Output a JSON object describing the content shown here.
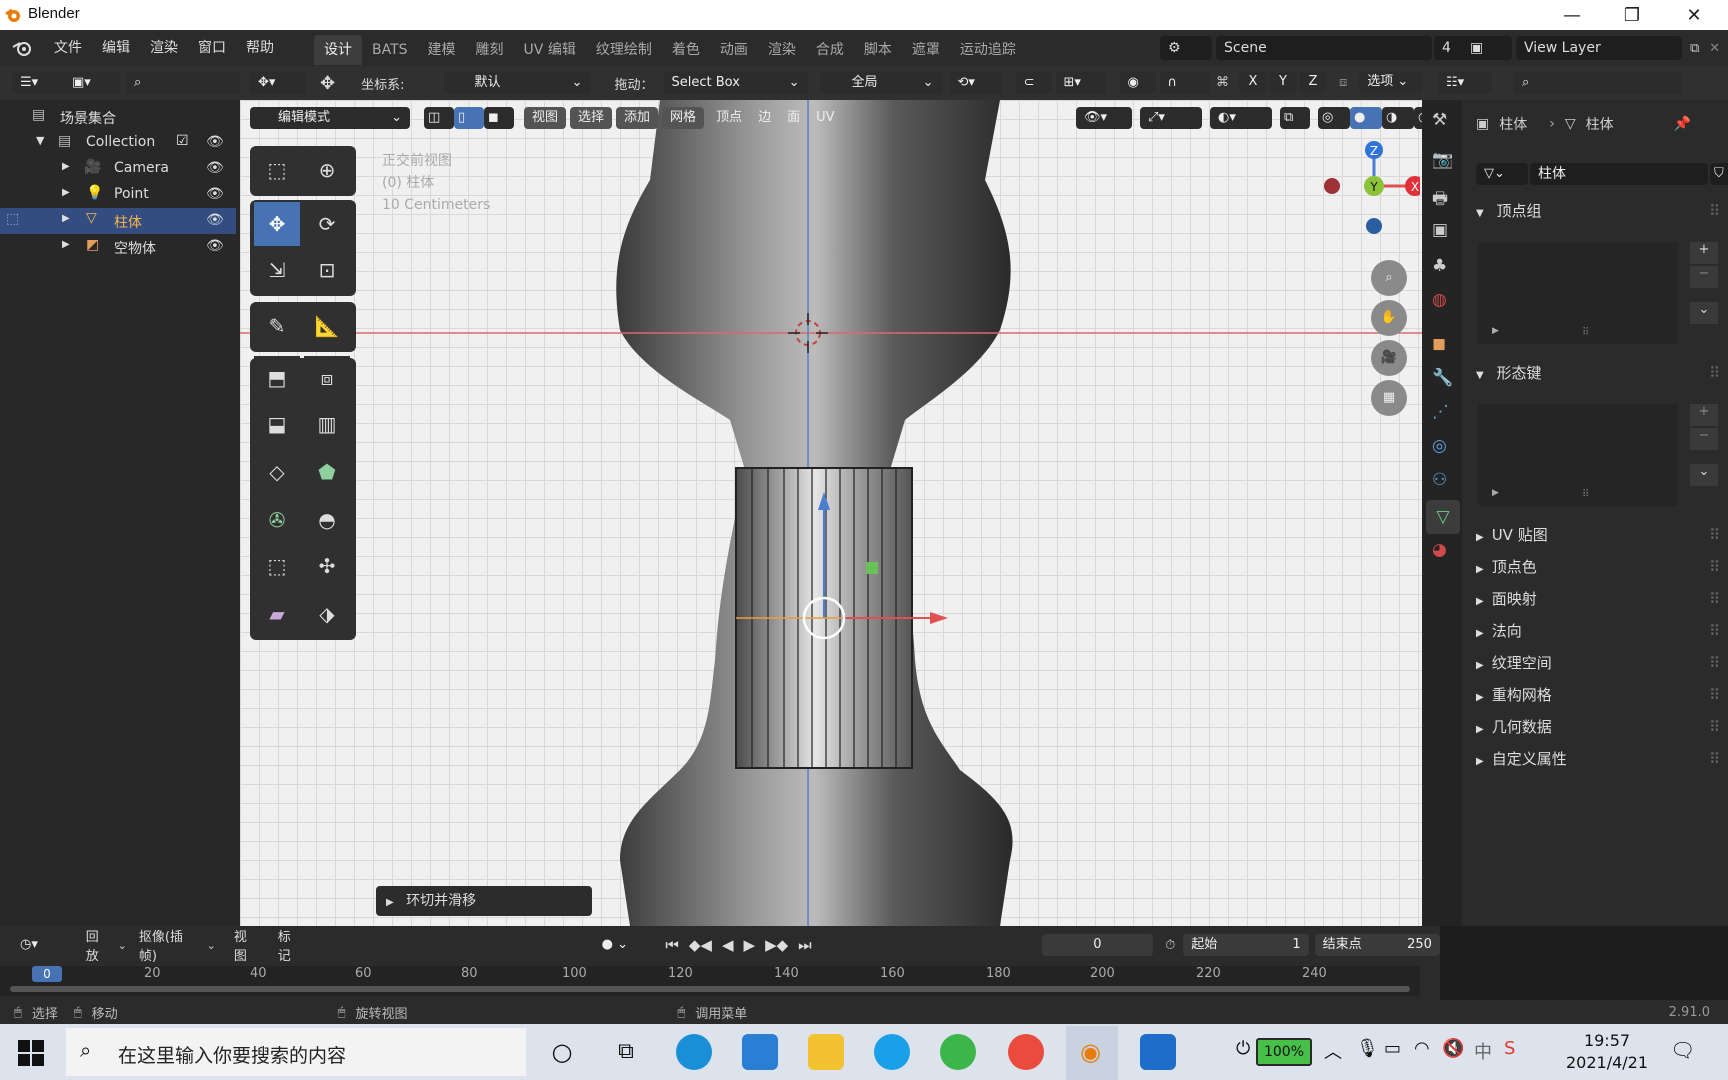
{
  "window": {
    "title": "Blender"
  },
  "topbar": {
    "menus": [
      "文件",
      "编辑",
      "渲染",
      "窗口",
      "帮助"
    ],
    "workspaces": [
      "设计",
      "BATS",
      "建模",
      "雕刻",
      "UV 编辑",
      "纹理绘制",
      "着色",
      "动画",
      "渲染",
      "合成",
      "脚本",
      "遮罩",
      "运动追踪"
    ],
    "active_workspace": "设计",
    "scene": "Scene",
    "scene_count": "4",
    "view_layer": "View Layer"
  },
  "tool_header": {
    "coord_label": "坐标系:",
    "coord_value": "默认",
    "drag_label": "拖动：",
    "drag_value": "Select Box",
    "pivot_value": "全局",
    "axes": [
      "X",
      "Y",
      "Z"
    ],
    "options": "选项"
  },
  "viewport_header": {
    "mode": "编辑模式",
    "menus": [
      "视图",
      "选择",
      "添加",
      "网格",
      "顶点",
      "边",
      "面",
      "UV"
    ]
  },
  "viewport": {
    "overlay_line1": "正交前视图",
    "overlay_line2": "(0) 柱体",
    "overlay_line3": "10 Centimeters",
    "operator_panel": "环切并滑移",
    "gizmo_axes": [
      "Z",
      "Y",
      "X"
    ]
  },
  "outliner": {
    "root": "场景集合",
    "items": [
      {
        "label": "Collection",
        "selected": false
      },
      {
        "label": "Camera",
        "selected": false
      },
      {
        "label": "Point",
        "selected": false
      },
      {
        "label": "柱体",
        "selected": true
      },
      {
        "label": "空物体",
        "selected": false
      }
    ]
  },
  "properties": {
    "object_name": "柱体",
    "data_name": "柱体",
    "mesh_name": "柱体",
    "panels_open": [
      "顶点组",
      "形态键"
    ],
    "panels_closed": [
      "UV 贴图",
      "顶点色",
      "面映射",
      "法向",
      "纹理空间",
      "重构网格",
      "几何数据",
      "自定义属性"
    ]
  },
  "timeline": {
    "menus": [
      "回放",
      "抠像(插帧)",
      "视图",
      "标记"
    ],
    "current_frame": "0",
    "start_label": "起始",
    "start": "1",
    "end_label": "结束点",
    "end": "250",
    "ticks": [
      "0",
      "20",
      "40",
      "60",
      "80",
      "100",
      "120",
      "140",
      "160",
      "180",
      "200",
      "220",
      "240"
    ]
  },
  "statusbar": {
    "select": "选择",
    "move": "移动",
    "rotate": "旋转视图",
    "menu": "调用菜单",
    "version": "2.91.0"
  },
  "taskbar": {
    "search_placeholder": "在这里输入你要搜索的内容",
    "battery": "100%",
    "time": "19:57",
    "date": "2021/4/21"
  }
}
